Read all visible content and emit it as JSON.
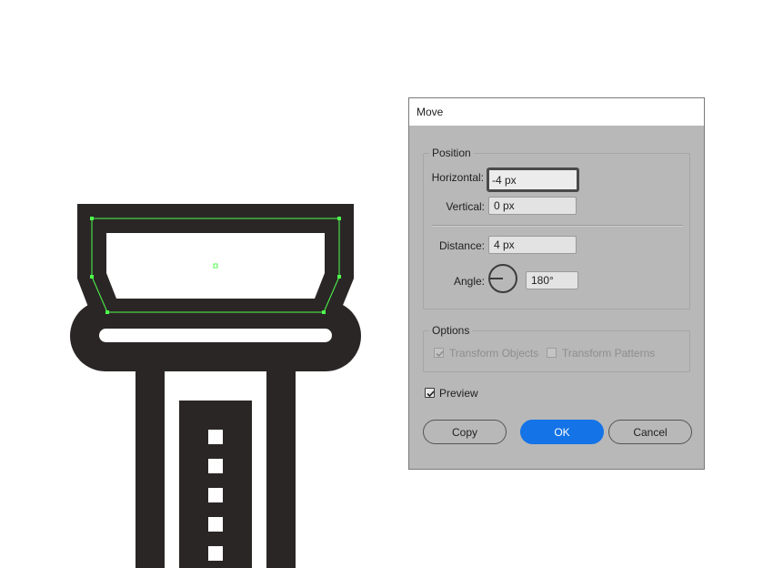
{
  "dialog": {
    "title": "Move",
    "position_group": {
      "legend": "Position",
      "horizontal_label": "Horizontal:",
      "horizontal_value": "-4 px",
      "vertical_label": "Vertical:",
      "vertical_value": "0 px",
      "distance_label": "Distance:",
      "distance_value": "4 px",
      "angle_label": "Angle:",
      "angle_value": "180°",
      "angle_dial_degrees": 180
    },
    "options_group": {
      "legend": "Options",
      "transform_objects_label": "Transform Objects",
      "transform_objects_checked": true,
      "transform_objects_enabled": false,
      "transform_patterns_label": "Transform Patterns",
      "transform_patterns_checked": false,
      "transform_patterns_enabled": false
    },
    "preview": {
      "label": "Preview",
      "checked": true
    },
    "buttons": {
      "copy": "Copy",
      "ok": "OK",
      "cancel": "Cancel"
    }
  },
  "colors": {
    "artwork_fill": "#2b2626",
    "selection_outline": "#4cff4c",
    "dialog_bg": "#b8b8b8",
    "accent": "#1473e6"
  }
}
